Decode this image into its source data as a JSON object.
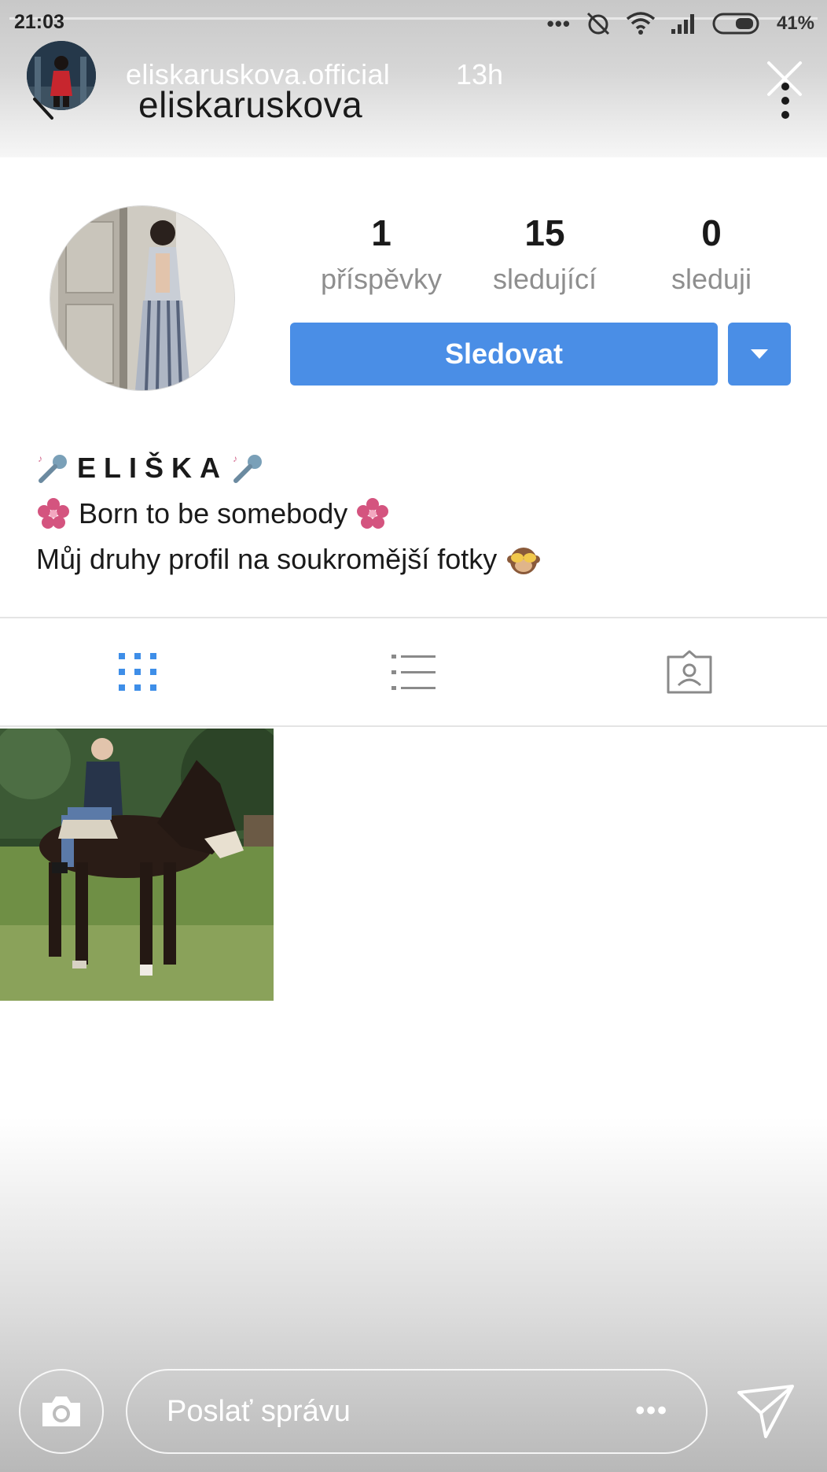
{
  "status_bar": {
    "time": "21:03",
    "overflow": "•••",
    "battery_percent": "41%"
  },
  "story": {
    "username": "eliskaruskova.official",
    "time_ago": "13h",
    "message_placeholder": "Poslať správu",
    "message_more": "•••"
  },
  "profile": {
    "header_username": "eliskaruskova",
    "stats": [
      {
        "value": "1",
        "label": "příspěvky"
      },
      {
        "value": "15",
        "label": "sledující"
      },
      {
        "value": "0",
        "label": "sleduji"
      }
    ],
    "follow_label": "Sledovat",
    "bio": {
      "name": "ELIŠKA",
      "line2": "Born to be somebody",
      "line3": "Můj druhy profil na soukromější fotky"
    }
  },
  "tabs": [
    {
      "name": "grid-view",
      "icon": "grid-icon",
      "active": true
    },
    {
      "name": "list-view",
      "icon": "list-icon",
      "active": false
    },
    {
      "name": "tagged",
      "icon": "tagged-person-icon",
      "active": false
    }
  ],
  "colors": {
    "accent": "#4a8ee6",
    "stat_label": "#8e8e8e",
    "tab_active": "#3e8ee8",
    "tab_inactive": "#8a8a8a"
  },
  "icons": {
    "emoji_left": "microphone-icon",
    "emoji_flower": "cherry-blossom-icon",
    "emoji_monkey": "see-no-evil-monkey-icon"
  }
}
